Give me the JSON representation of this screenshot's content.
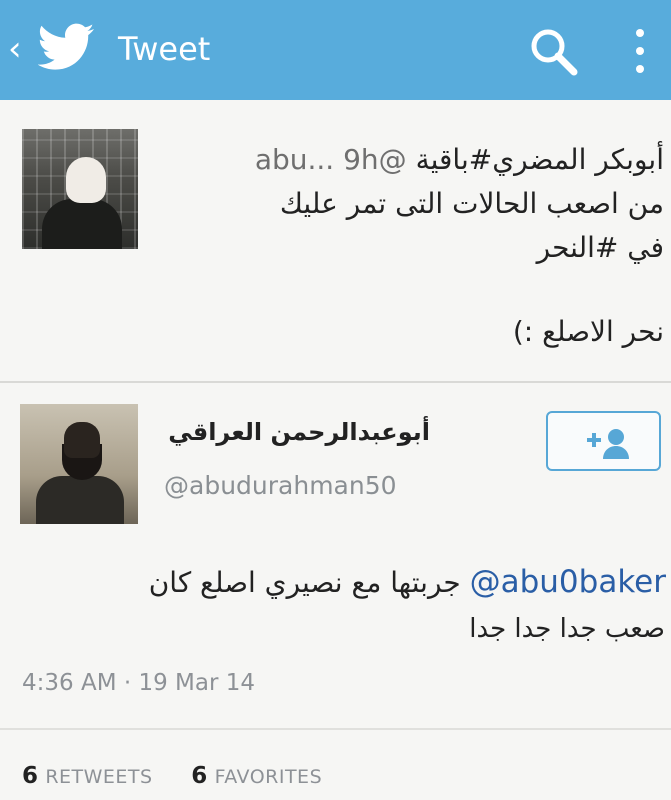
{
  "header": {
    "back_glyph": "‹",
    "title": "Tweet",
    "color": "#58acdc"
  },
  "quoted_tweet": {
    "time": "9h",
    "handle": "@abu...",
    "text_head": "أبوبكر المضري#باقية",
    "line2": "من اصعب الحالات التى تمر عليك",
    "line3": "في #النحر",
    "line4": "نحر الاصلع :)"
  },
  "reply": {
    "name": "أبوعبدالرحمن العراقي",
    "handle": "@abudurahman50",
    "mention": "@abu0baker",
    "text": "جربتها مع نصيري اصلع كان",
    "text_line2": "صعب جدا جدا جدا",
    "timestamp": "4:36 AM · 19 Mar 14",
    "retweets_count": "6",
    "retweets_label": "RETWEETS",
    "favorites_count": "6",
    "favorites_label": "FAVORITES"
  },
  "icons": {
    "back": "chevron-left-icon",
    "logo": "twitter-bird-icon",
    "search": "search-icon",
    "menu": "more-vertical-icon",
    "follow": "add-user-icon"
  },
  "colors": {
    "accent": "#58acdc",
    "mention": "#2a5ea6",
    "muted": "#8d9196"
  }
}
